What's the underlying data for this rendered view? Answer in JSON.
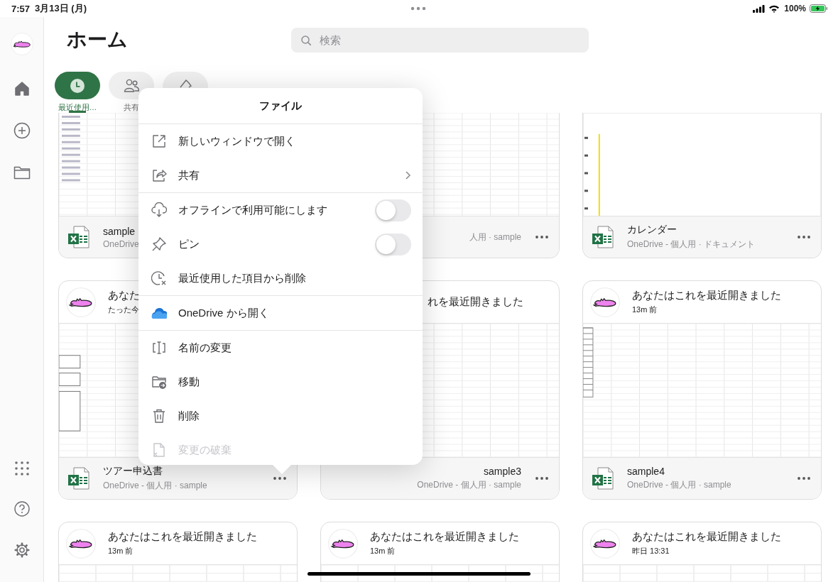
{
  "status_bar": {
    "time": "7:57",
    "date": "3月13日 (月)",
    "battery": "100%"
  },
  "page": {
    "title": "ホーム"
  },
  "search": {
    "placeholder": "検索"
  },
  "tabs": [
    {
      "label": "最近使用…",
      "selected": true
    },
    {
      "label": "共有",
      "selected": false
    },
    {
      "selected": false
    }
  ],
  "files": [
    {
      "kind": "right_covered",
      "preview": {
        "kind": "list"
      },
      "footer": {
        "name": "sample",
        "location": "OneDrive"
      }
    },
    {
      "kind": "left_covered",
      "preview": {
        "kind": "sheet"
      },
      "footer": {
        "location": "人用 · sample"
      }
    },
    {
      "kind": "full",
      "preview": {
        "kind": "calendar"
      },
      "footer": {
        "name": "カレンダー",
        "location": "OneDrive - 個人用 · ドキュメント"
      }
    },
    {
      "kind": "full",
      "header": {
        "title": "あなた",
        "time": "たった今"
      },
      "preview": {
        "kind": "form"
      },
      "footer": {
        "name": "ツアー申込書",
        "location": "OneDrive - 個人用 · sample"
      }
    },
    {
      "kind": "left_covered",
      "header": {
        "title": "れを最近開きました"
      },
      "preview": {
        "kind": "sheet"
      },
      "footer": {
        "name": "sample3",
        "location": "OneDrive - 個人用 · sample"
      }
    },
    {
      "kind": "full",
      "header": {
        "title": "あなたはこれを最近開きました",
        "time": "13m 前"
      },
      "preview": {
        "kind": "table"
      },
      "footer": {
        "name": "sample4",
        "location": "OneDrive - 個人用 · sample"
      }
    },
    {
      "kind": "full",
      "header": {
        "title": "あなたはこれを最近開きました",
        "time": "13m 前"
      },
      "preview": {
        "kind": "sheet"
      }
    },
    {
      "kind": "full",
      "header": {
        "title": "あなたはこれを最近開きました",
        "time": "13m 前"
      },
      "preview": {
        "kind": "sheet"
      }
    },
    {
      "kind": "full",
      "header": {
        "title": "あなたはこれを最近開きました",
        "time": "昨日 13:31"
      },
      "preview": {
        "kind": "sheet"
      }
    }
  ],
  "menu": {
    "title": "ファイル",
    "groups": [
      [
        {
          "label": "新しいウィンドウで開く",
          "kind": "action",
          "disabled": false
        },
        {
          "label": "共有",
          "kind": "submenu",
          "disabled": false
        }
      ],
      [
        {
          "label": "オフラインで利用可能にします",
          "kind": "toggle",
          "on": false,
          "disabled": false
        },
        {
          "label": "ピン",
          "kind": "toggle",
          "on": false,
          "disabled": false
        },
        {
          "label": "最近使用した項目から削除",
          "kind": "action",
          "disabled": false
        }
      ],
      [
        {
          "label": "OneDrive から開く",
          "kind": "action",
          "disabled": false
        }
      ],
      [
        {
          "label": "名前の変更",
          "kind": "action",
          "disabled": false
        },
        {
          "label": "移動",
          "kind": "action",
          "disabled": false
        },
        {
          "label": "削除",
          "kind": "action",
          "disabled": false
        },
        {
          "label": "変更の破棄",
          "kind": "action",
          "disabled": true
        }
      ]
    ]
  }
}
